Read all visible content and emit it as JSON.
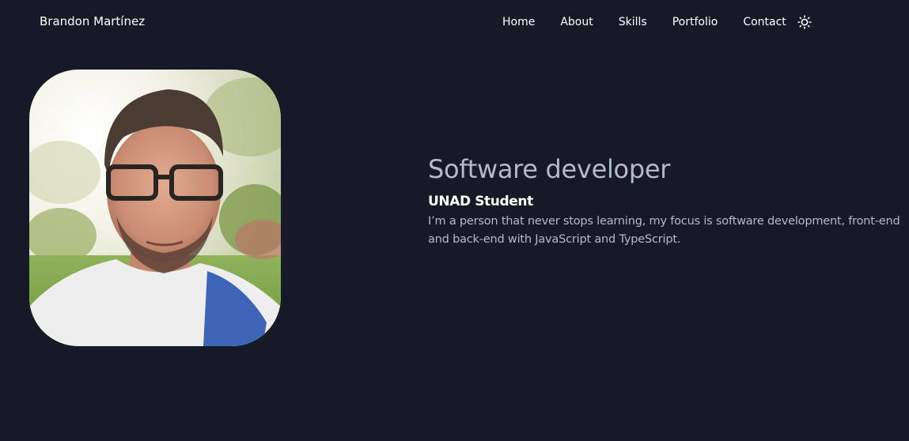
{
  "navbar": {
    "brand": "Brandon Martínez",
    "links": [
      {
        "label": "Home"
      },
      {
        "label": "About"
      },
      {
        "label": "Skills"
      },
      {
        "label": "Portfolio"
      },
      {
        "label": "Contact"
      }
    ],
    "theme_toggle_icon": "sun-icon"
  },
  "hero": {
    "title": "Software developer",
    "subtitle": "UNAD Student",
    "description": "I’m a person that never stops learning, my focus is software development, front-end and back-end with JavaScript and TypeScript."
  },
  "colors": {
    "background": "#161a27",
    "text_primary": "#ffffff",
    "text_muted": "#b5b9c8"
  }
}
